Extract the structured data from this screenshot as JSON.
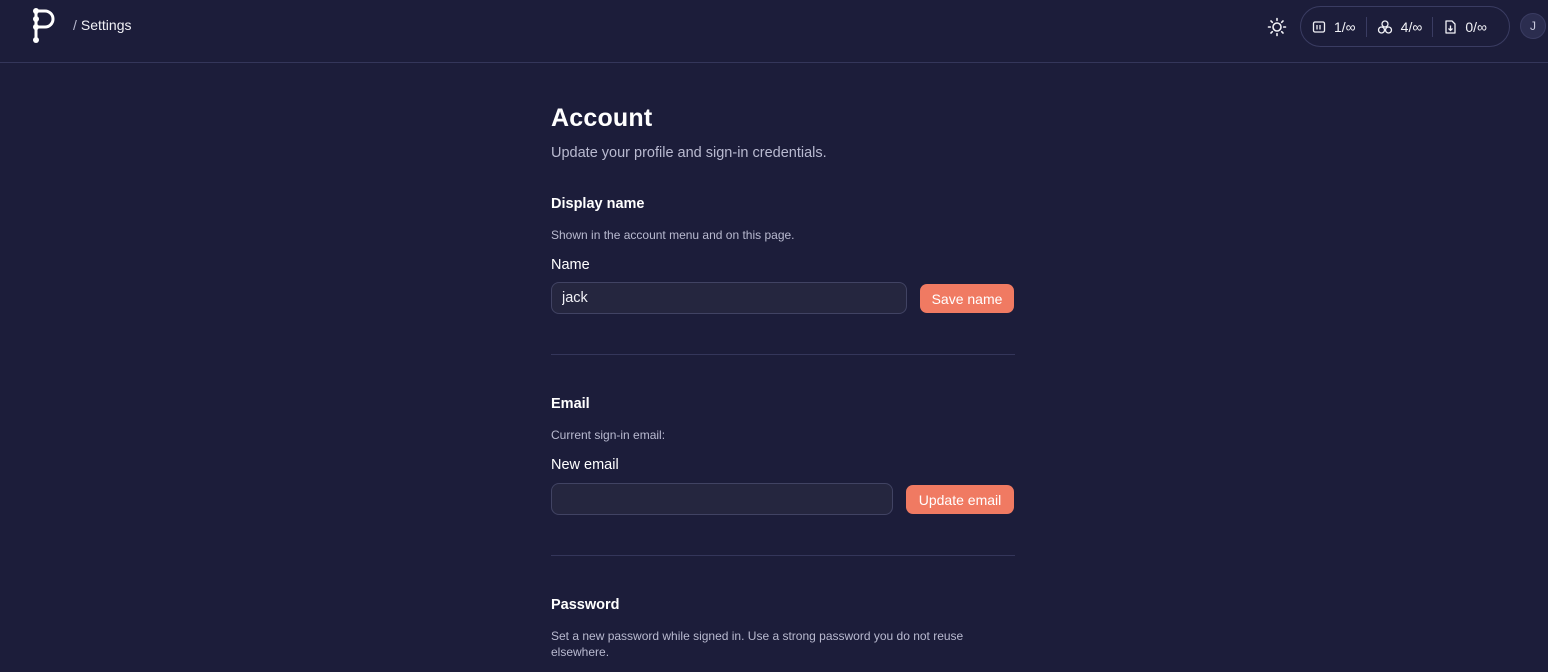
{
  "header": {
    "breadcrumb_sep": "/",
    "breadcrumb": "Settings",
    "usage": [
      {
        "icon": "presentation-icon",
        "value": "1/∞"
      },
      {
        "icon": "cluster-icon",
        "value": "4/∞"
      },
      {
        "icon": "download-file-icon",
        "value": "0/∞"
      }
    ],
    "avatar_initial": "J"
  },
  "page": {
    "title": "Account",
    "subtitle": "Update your profile and sign-in credentials."
  },
  "display_name": {
    "title": "Display name",
    "description": "Shown in the account menu and on this page.",
    "label": "Name",
    "value": "jack",
    "save_label": "Save name"
  },
  "email": {
    "title": "Email",
    "description": "Current sign-in email:",
    "label": "New email",
    "value": "",
    "update_label": "Update email"
  },
  "password": {
    "title": "Password",
    "description": "Set a new password while signed in. Use a strong password you do not reuse elsewhere."
  },
  "colors": {
    "background": "#1c1d3a",
    "accent": "#f07a62"
  }
}
